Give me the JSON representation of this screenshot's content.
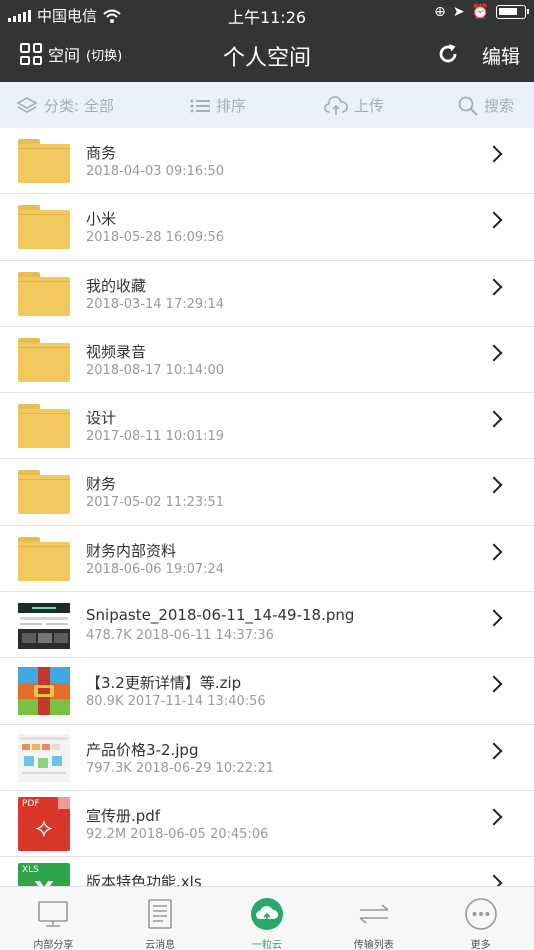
{
  "status": {
    "carrier": "中国电信",
    "time": "上午11:26"
  },
  "nav": {
    "switch_label": "空间",
    "switch_sub": "(切换)",
    "title": "个人空间",
    "edit_label": "编辑"
  },
  "toolbar": {
    "category": "分类: 全部",
    "sort": "排序",
    "upload": "上传",
    "search": "搜索"
  },
  "files": [
    {
      "name": "商务",
      "meta": "2018-04-03 09:16:50",
      "type": "folder"
    },
    {
      "name": "小米",
      "meta": "2018-05-28 16:09:56",
      "type": "folder"
    },
    {
      "name": "我的收藏",
      "meta": "2018-03-14 17:29:14",
      "type": "folder"
    },
    {
      "name": "视频录音",
      "meta": "2018-08-17 10:14:00",
      "type": "folder"
    },
    {
      "name": "设计",
      "meta": "2017-08-11 10:01:19",
      "type": "folder"
    },
    {
      "name": "财务",
      "meta": "2017-05-02 11:23:51",
      "type": "folder"
    },
    {
      "name": "财务内部资料",
      "meta": "2018-06-06 19:07:24",
      "type": "folder"
    },
    {
      "name": "Snipaste_2018-06-11_14-49-18.png",
      "meta": "478.7K  2018-06-11 14:37:36",
      "type": "png"
    },
    {
      "name": "【3.2更新详情】等.zip",
      "meta": "80.9K  2017-11-14 13:40:56",
      "type": "zip"
    },
    {
      "name": "产品价格3-2.jpg",
      "meta": "797.3K  2018-06-29 10:22:21",
      "type": "jpg"
    },
    {
      "name": "宣传册.pdf",
      "meta": "92.2M  2018-06-05 20:45:06",
      "type": "pdf"
    },
    {
      "name": "版本特色功能.xls",
      "meta": "",
      "type": "xls"
    }
  ],
  "file_badges": {
    "pdf": "PDF",
    "xls": "XLS"
  },
  "tabs": [
    {
      "label": "内部分享",
      "icon": "monitor-icon"
    },
    {
      "label": "云消息",
      "icon": "newspaper-icon"
    },
    {
      "label": "一粒云",
      "icon": "cloud-icon",
      "active": true
    },
    {
      "label": "传输列表",
      "icon": "transfer-arrows-icon"
    },
    {
      "label": "更多",
      "icon": "more-dots-icon"
    }
  ],
  "colors": {
    "nav_bg": "#333436",
    "toolbar_bg": "#e9f2fb",
    "folder": "#f2c95f",
    "accent": "#28a86b"
  }
}
